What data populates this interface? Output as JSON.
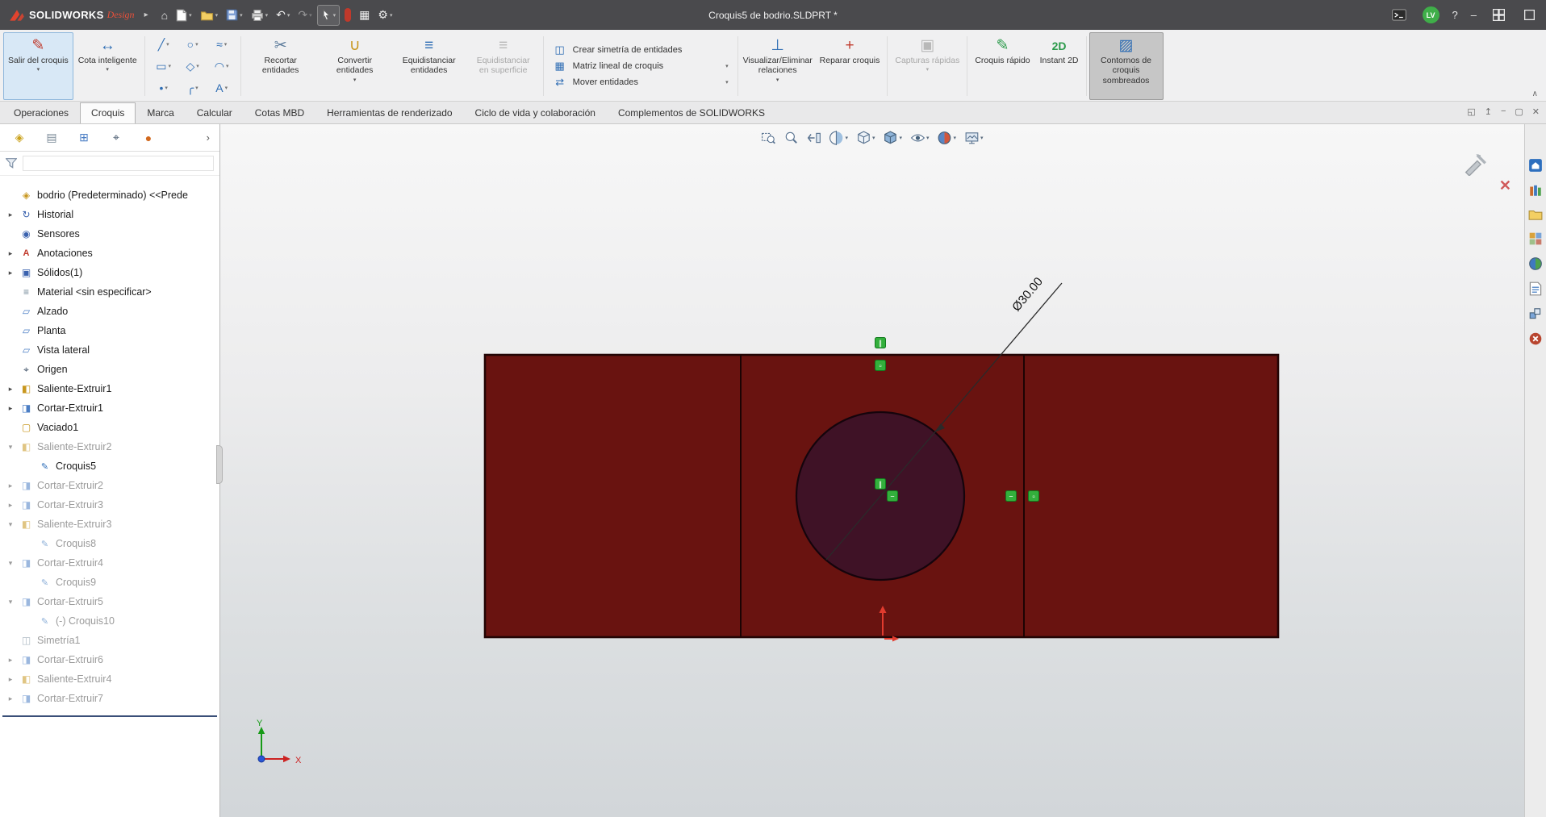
{
  "icons": {
    "home": "⌂",
    "undo": "↶",
    "redo": "↷",
    "gear": "⚙",
    "help": "?",
    "minimize": "–",
    "flyout": "▸",
    "caret": "▾",
    "chevron": "›",
    "collapse": "∧",
    "doc_controls": [
      "◱",
      "↥",
      "−",
      "▢",
      "✕"
    ],
    "line": "╱",
    "circle": "○",
    "spline": "≈",
    "rect": "▭",
    "polygon": "◇",
    "arc": "◠",
    "point": "•",
    "fillet": "╭",
    "text": "A",
    "pencil": "✎",
    "dim": "↔",
    "scissors": "✂",
    "convert": "∪",
    "offset": "≡",
    "mirror": "◫",
    "pattern": "▦",
    "move": "⇄",
    "relations": "⊥",
    "repair": "+",
    "camera": "▣",
    "instant2d": "2D",
    "shaded": "▨",
    "part": "◈",
    "history": "↻",
    "sensors": "◉",
    "annotations": "A",
    "solids": "▣",
    "material": "≡",
    "plane": "▱",
    "origin": "⌖",
    "boss": "◧",
    "cut": "◨",
    "shell": "▢",
    "sketch": "✎",
    "mirror_f": "◫",
    "pt1": "◈",
    "pt2": "▤",
    "pt3": "⊞",
    "pt4": "⌖",
    "pt5": "●"
  },
  "titlebar": {
    "brand": "SOLIDWORKS",
    "brand_suffix": "Design",
    "title": "Croquis5 de bodrio.SLDPRT *",
    "avatar": "LV"
  },
  "ribbon": {
    "exit_sketch": "Salir del croquis",
    "smart_dimension": "Cota inteligente",
    "trim": "Recortar entidades",
    "convert": "Convertir entidades",
    "offset": "Equidistanciar entidades",
    "offset_surface": "Equidistanciar en superficie",
    "mirror": "Crear simetría de entidades",
    "linear_pattern": "Matriz lineal de croquis",
    "move": "Mover entidades",
    "display_relations": "Visualizar/Eliminar relaciones",
    "repair": "Reparar croquis",
    "snapshots": "Capturas rápidas",
    "rapid_sketch": "Croquis rápido",
    "instant_2d": "Instant 2D",
    "shaded_contours": "Contornos de croquis sombreados"
  },
  "tabs": [
    "Operaciones",
    "Croquis",
    "Marca",
    "Calcular",
    "Cotas MBD",
    "Herramientas de renderizado",
    "Ciclo de vida y colaboración",
    "Complementos de SOLIDWORKS"
  ],
  "tree": {
    "items": [
      {
        "label": "bodrio (Predeterminado) <<Prede"
      },
      {
        "label": "Historial"
      },
      {
        "label": "Sensores"
      },
      {
        "label": "Anotaciones"
      },
      {
        "label": "Sólidos(1)"
      },
      {
        "label": "Material <sin especificar>"
      },
      {
        "label": "Alzado"
      },
      {
        "label": "Planta"
      },
      {
        "label": "Vista lateral"
      },
      {
        "label": "Origen"
      },
      {
        "label": "Saliente-Extruir1"
      },
      {
        "label": "Cortar-Extruir1"
      },
      {
        "label": "Vaciado1"
      },
      {
        "label": "Saliente-Extruir2"
      },
      {
        "label": "Croquis5"
      },
      {
        "label": "Cortar-Extruir2"
      },
      {
        "label": "Cortar-Extruir3"
      },
      {
        "label": "Saliente-Extruir3"
      },
      {
        "label": "Croquis8"
      },
      {
        "label": "Cortar-Extruir4"
      },
      {
        "label": "Croquis9"
      },
      {
        "label": "Cortar-Extruir5"
      },
      {
        "label": "(-) Croquis10"
      },
      {
        "label": "Simetría1"
      },
      {
        "label": "Cortar-Extruir6"
      },
      {
        "label": "Saliente-Extruir4"
      },
      {
        "label": "Cortar-Extruir7"
      }
    ]
  },
  "viewport": {
    "dimension": "Ø30.00",
    "axis_x": "X",
    "axis_y": "Y",
    "relations": [
      "∥",
      "▫",
      "∥",
      "−",
      "−",
      "▫"
    ]
  }
}
